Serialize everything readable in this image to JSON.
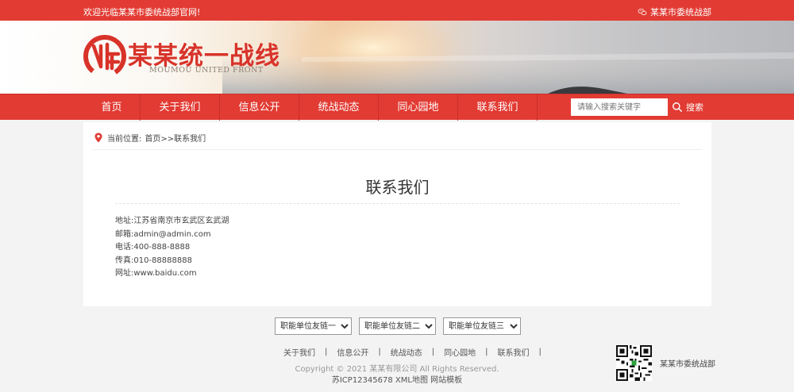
{
  "topbar": {
    "welcome": "欢迎光临某某市委统战部官网!",
    "org_name": "某某市委统战部"
  },
  "brand": {
    "title": "某某统一战线",
    "subtitle": "MOUMOU UNITED FRONT"
  },
  "nav": {
    "items": [
      {
        "label": "首页"
      },
      {
        "label": "关于我们"
      },
      {
        "label": "信息公开"
      },
      {
        "label": "统战动态"
      },
      {
        "label": "同心园地"
      },
      {
        "label": "联系我们"
      }
    ],
    "search_placeholder": "请输入搜索关键字",
    "search_button": "搜索"
  },
  "breadcrumb": {
    "prefix": "当前位置:",
    "path": "首页>>联系我们"
  },
  "page": {
    "title": "联系我们",
    "info": [
      {
        "label": "地址:",
        "value": "江苏省南京市玄武区玄武湖"
      },
      {
        "label": "邮箱:",
        "value": "admin@admin.com"
      },
      {
        "label": "电话:",
        "value": "400-888-8888"
      },
      {
        "label": "传真:",
        "value": "010-88888888"
      },
      {
        "label": "网址:",
        "value": "www.baidu.com"
      }
    ]
  },
  "footer": {
    "link_selects": [
      "职能单位友链一",
      "职能单位友链二",
      "职能单位友链三"
    ],
    "menu": [
      "关于我们",
      "信息公开",
      "统战动态",
      "同心园地",
      "联系我们"
    ],
    "separator": "|",
    "copyright": "Copyright © 2021 某某有限公司 All Rights Reserved.",
    "icp": "苏ICP12345678 XML地图 网站模板",
    "qr_label": "某某市委统战部"
  },
  "colors": {
    "primary_red": "#e23b33",
    "page_bg": "#f3f3f3"
  }
}
